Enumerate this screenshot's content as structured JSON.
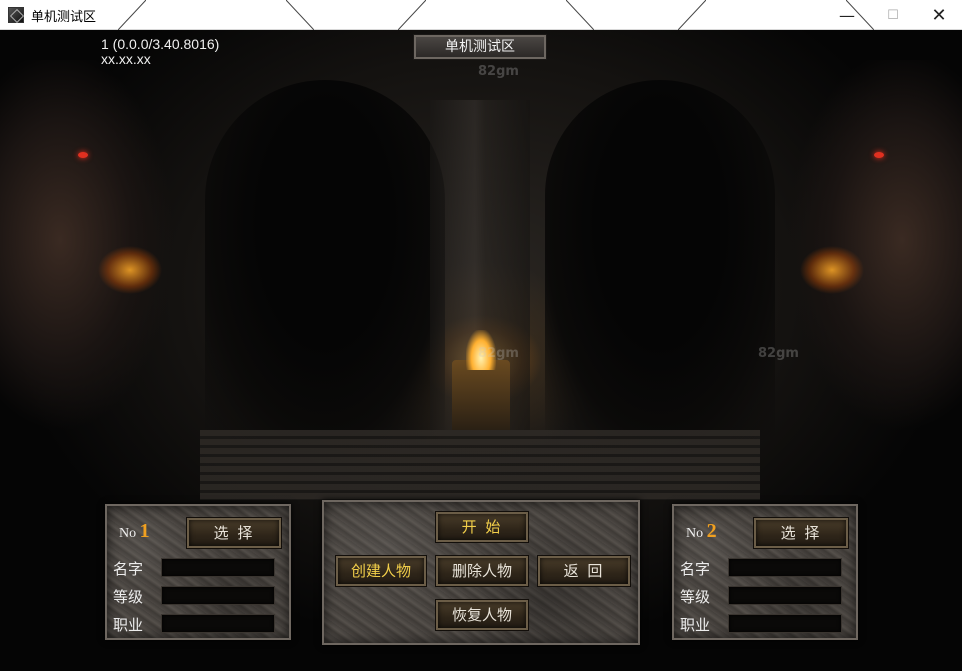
{
  "window": {
    "title": "单机测试区",
    "controls": {
      "minimize": "—",
      "maximize": "☐",
      "close": "✕"
    }
  },
  "hud": {
    "version": "1 (0.0.0/3.40.8016)",
    "ip": "xx.xx.xx",
    "server_name": "单机测试区"
  },
  "watermark": "82gm",
  "slot1": {
    "no_label": "No",
    "number": "1",
    "select_label": "选 择",
    "fields": {
      "name": "名字",
      "level": "等级",
      "job": "职业"
    },
    "values": {
      "name": "",
      "level": "",
      "job": ""
    }
  },
  "slot2": {
    "no_label": "No",
    "number": "2",
    "select_label": "选 择",
    "fields": {
      "name": "名字",
      "level": "等级",
      "job": "职业"
    },
    "values": {
      "name": "",
      "level": "",
      "job": ""
    }
  },
  "center": {
    "start": "开 始",
    "create": "创建人物",
    "delete": "删除人物",
    "back": "返 回",
    "restore": "恢复人物"
  },
  "colors": {
    "accent_gold": "#f2cf4a",
    "slot_number": "#f0a020"
  }
}
